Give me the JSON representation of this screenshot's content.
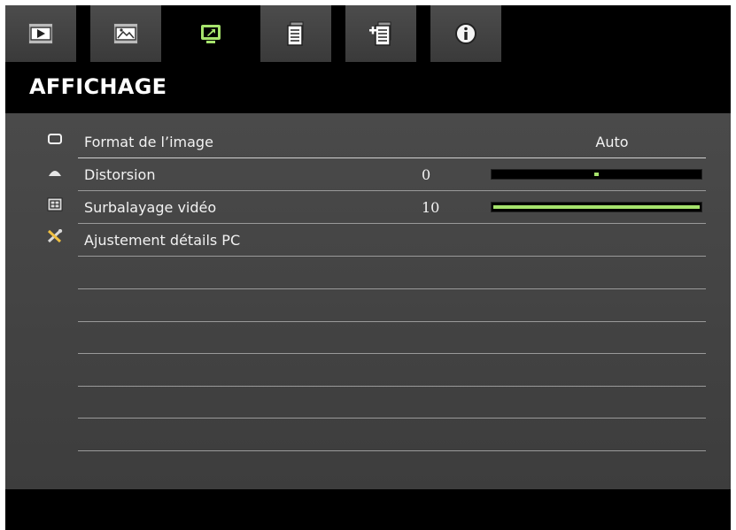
{
  "tabs": [
    {
      "name": "tab-image",
      "icon": "play-icon",
      "active": false
    },
    {
      "name": "tab-picture",
      "icon": "picture-icon",
      "active": false
    },
    {
      "name": "tab-display",
      "icon": "display-icon",
      "active": true
    },
    {
      "name": "tab-setup",
      "icon": "document-icon",
      "active": false
    },
    {
      "name": "tab-options",
      "icon": "document-add-icon",
      "active": false
    },
    {
      "name": "tab-info",
      "icon": "info-icon",
      "active": false
    }
  ],
  "header": {
    "title": "AFFICHAGE"
  },
  "menu": [
    {
      "label": "Format de l’image",
      "value": "Auto",
      "icon": "rectangle-icon"
    },
    {
      "label": "Distorsion",
      "number": "0",
      "level": 0.5,
      "icon": "keystone-icon"
    },
    {
      "label": "Surbalayage vidéo",
      "number": "10",
      "level": 1.0,
      "icon": "overscan-icon"
    },
    {
      "label": "Ajustement détails PC",
      "icon": "tools-icon"
    }
  ],
  "colors": {
    "accent": "#a6e36c",
    "panel": "#444444",
    "background": "#000000"
  }
}
